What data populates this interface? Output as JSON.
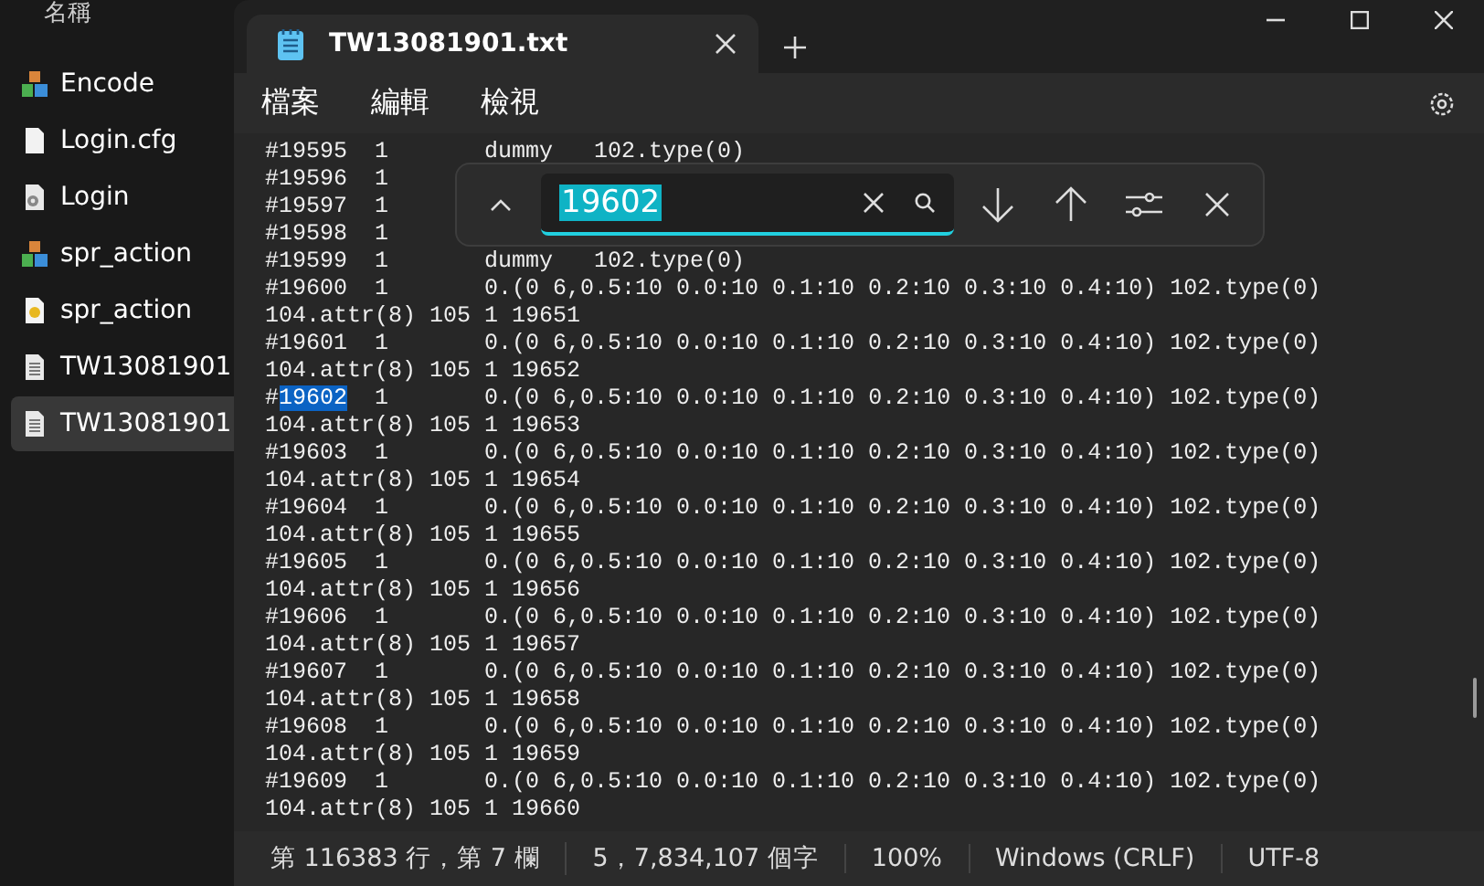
{
  "explorer": {
    "header": "名稱",
    "items": [
      {
        "name": "Encode",
        "kind": "app",
        "selected": false
      },
      {
        "name": "Login.cfg",
        "kind": "blank",
        "selected": false
      },
      {
        "name": "Login",
        "kind": "settings",
        "selected": false
      },
      {
        "name": "spr_action",
        "kind": "app",
        "selected": false
      },
      {
        "name": "spr_action",
        "kind": "image",
        "selected": false
      },
      {
        "name": "TW13081901",
        "kind": "text",
        "selected": false
      },
      {
        "name": "TW13081901",
        "kind": "text",
        "selected": true
      }
    ]
  },
  "tabs": [
    {
      "label": "TW13081901.txt",
      "selected": true
    }
  ],
  "menu": [
    "檔案",
    "編輯",
    "檢視"
  ],
  "find": {
    "value": "19602",
    "value_selected": true
  },
  "lines": [
    {
      "text": "#19595  1       dummy   102.type(0)"
    },
    {
      "text": "#19596  1"
    },
    {
      "text": "#19597  1"
    },
    {
      "text": "#19598  1"
    },
    {
      "text": "#19599  1       dummy   102.type(0)"
    },
    {
      "text": "#19600  1       0.(0 6,0.5:10 0.0:10 0.1:10 0.2:10 0.3:10 0.4:10) 102.type(0)"
    },
    {
      "text": "104.attr(8) 105 1 19651"
    },
    {
      "text": "#19601  1       0.(0 6,0.5:10 0.0:10 0.1:10 0.2:10 0.3:10 0.4:10) 102.type(0)"
    },
    {
      "text": "104.attr(8) 105 1 19652"
    },
    {
      "before": "#",
      "match": "19602",
      "after": "  1       0.(0 6,0.5:10 0.0:10 0.1:10 0.2:10 0.3:10 0.4:10) 102.type(0)"
    },
    {
      "text": "104.attr(8) 105 1 19653"
    },
    {
      "text": "#19603  1       0.(0 6,0.5:10 0.0:10 0.1:10 0.2:10 0.3:10 0.4:10) 102.type(0)"
    },
    {
      "text": "104.attr(8) 105 1 19654"
    },
    {
      "text": "#19604  1       0.(0 6,0.5:10 0.0:10 0.1:10 0.2:10 0.3:10 0.4:10) 102.type(0)"
    },
    {
      "text": "104.attr(8) 105 1 19655"
    },
    {
      "text": "#19605  1       0.(0 6,0.5:10 0.0:10 0.1:10 0.2:10 0.3:10 0.4:10) 102.type(0)"
    },
    {
      "text": "104.attr(8) 105 1 19656"
    },
    {
      "text": "#19606  1       0.(0 6,0.5:10 0.0:10 0.1:10 0.2:10 0.3:10 0.4:10) 102.type(0)"
    },
    {
      "text": "104.attr(8) 105 1 19657"
    },
    {
      "text": "#19607  1       0.(0 6,0.5:10 0.0:10 0.1:10 0.2:10 0.3:10 0.4:10) 102.type(0)"
    },
    {
      "text": "104.attr(8) 105 1 19658"
    },
    {
      "text": "#19608  1       0.(0 6,0.5:10 0.0:10 0.1:10 0.2:10 0.3:10 0.4:10) 102.type(0)"
    },
    {
      "text": "104.attr(8) 105 1 19659"
    },
    {
      "text": "#19609  1       0.(0 6,0.5:10 0.0:10 0.1:10 0.2:10 0.3:10 0.4:10) 102.type(0)"
    },
    {
      "text": "104.attr(8) 105 1 19660"
    }
  ],
  "status_bar": [
    "第 116383 行，第 7 欄",
    "5，7,834,107 個字",
    "100%",
    "Windows (CRLF)",
    "UTF-8"
  ]
}
